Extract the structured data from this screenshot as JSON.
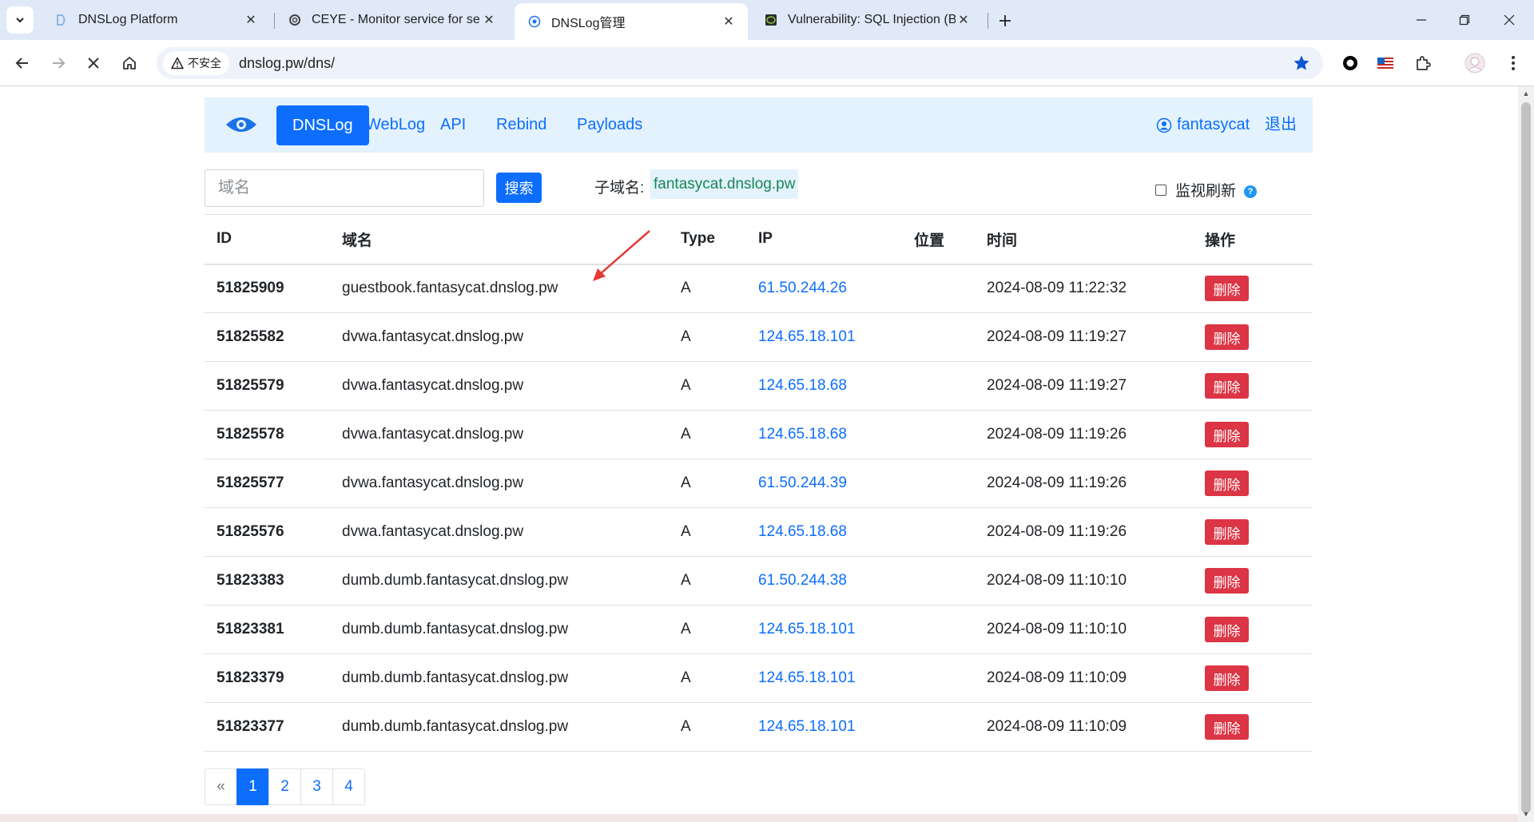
{
  "browser": {
    "tabs": [
      {
        "title": "DNSLog Platform",
        "favicon": "dnslog-platform-icon"
      },
      {
        "title": "CEYE - Monitor service for se",
        "favicon": "ceye-icon"
      },
      {
        "title": "DNSLog管理",
        "favicon": "eye-icon"
      },
      {
        "title": "Vulnerability: SQL Injection (B",
        "favicon": "dvwa-icon"
      }
    ],
    "active_tab": 2,
    "security_label": "不安全",
    "url": "dnslog.pw/dns/"
  },
  "navbar": {
    "links": [
      "DNSLog",
      "WebLog",
      "API",
      "Rebind",
      "Payloads"
    ],
    "active": "DNSLog",
    "username": "fantasycat",
    "logout": "退出"
  },
  "search": {
    "placeholder": "域名",
    "button": "搜索"
  },
  "subdomain": {
    "label": "子域名:",
    "value": "fantasycat.dnslog.pw"
  },
  "monitor": {
    "label": "监视刷新",
    "help": "?"
  },
  "table": {
    "headers": [
      "ID",
      "域名",
      "Type",
      "IP",
      "位置",
      "时间",
      "操作"
    ],
    "delete_label": "删除",
    "rows": [
      {
        "id": "51825909",
        "domain": "guestbook.fantasycat.dnslog.pw",
        "type": "A",
        "ip": "61.50.244.26",
        "location": "",
        "time": "2024-08-09 11:22:32"
      },
      {
        "id": "51825582",
        "domain": "dvwa.fantasycat.dnslog.pw",
        "type": "A",
        "ip": "124.65.18.101",
        "location": "",
        "time": "2024-08-09 11:19:27"
      },
      {
        "id": "51825579",
        "domain": "dvwa.fantasycat.dnslog.pw",
        "type": "A",
        "ip": "124.65.18.68",
        "location": "",
        "time": "2024-08-09 11:19:27"
      },
      {
        "id": "51825578",
        "domain": "dvwa.fantasycat.dnslog.pw",
        "type": "A",
        "ip": "124.65.18.68",
        "location": "",
        "time": "2024-08-09 11:19:26"
      },
      {
        "id": "51825577",
        "domain": "dvwa.fantasycat.dnslog.pw",
        "type": "A",
        "ip": "61.50.244.39",
        "location": "",
        "time": "2024-08-09 11:19:26"
      },
      {
        "id": "51825576",
        "domain": "dvwa.fantasycat.dnslog.pw",
        "type": "A",
        "ip": "124.65.18.68",
        "location": "",
        "time": "2024-08-09 11:19:26"
      },
      {
        "id": "51823383",
        "domain": "dumb.dumb.fantasycat.dnslog.pw",
        "type": "A",
        "ip": "61.50.244.38",
        "location": "",
        "time": "2024-08-09 11:10:10"
      },
      {
        "id": "51823381",
        "domain": "dumb.dumb.fantasycat.dnslog.pw",
        "type": "A",
        "ip": "124.65.18.101",
        "location": "",
        "time": "2024-08-09 11:10:10"
      },
      {
        "id": "51823379",
        "domain": "dumb.dumb.fantasycat.dnslog.pw",
        "type": "A",
        "ip": "124.65.18.101",
        "location": "",
        "time": "2024-08-09 11:10:09"
      },
      {
        "id": "51823377",
        "domain": "dumb.dumb.fantasycat.dnslog.pw",
        "type": "A",
        "ip": "124.65.18.101",
        "location": "",
        "time": "2024-08-09 11:10:09"
      }
    ]
  },
  "pagination": {
    "prev": "«",
    "pages": [
      "1",
      "2",
      "3",
      "4"
    ],
    "current": "1"
  },
  "colors": {
    "primary": "#0d6efd",
    "danger": "#dc3545",
    "navbar_bg": "#e3f2fd",
    "subdomain_text": "#198754",
    "annotation_arrow": "#e53935"
  }
}
